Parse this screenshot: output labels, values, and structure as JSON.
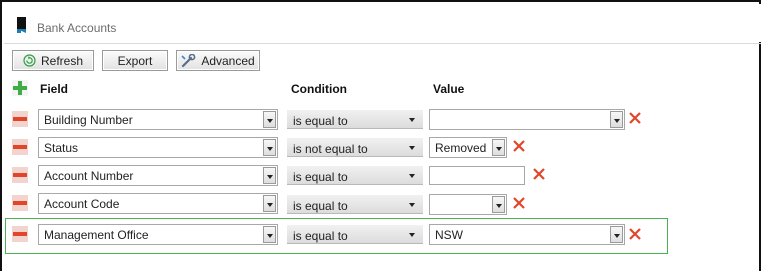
{
  "window": {
    "title": "Bank Accounts"
  },
  "toolbar": {
    "refresh_label": "Refresh",
    "export_label": "Export",
    "advanced_label": "Advanced"
  },
  "headers": {
    "field": "Field",
    "condition": "Condition",
    "value": "Value"
  },
  "filters": [
    {
      "field": "Building Number",
      "condition": "is equal to",
      "value": "",
      "value_type": "dropdown"
    },
    {
      "field": "Status",
      "condition": "is not equal to",
      "value": "Removed",
      "value_type": "dropdown"
    },
    {
      "field": "Account Number",
      "condition": "is equal to",
      "value": "",
      "value_type": "text"
    },
    {
      "field": "Account Code",
      "condition": "is equal to",
      "value": "",
      "value_type": "dropdown"
    },
    {
      "field": "Management Office",
      "condition": "is equal to",
      "value": "NSW",
      "value_type": "dropdown",
      "highlighted": true
    }
  ],
  "icons": {
    "app": "bank-accounts-icon",
    "refresh": "refresh-icon",
    "advanced": "wrench-icon",
    "add": "plus-icon",
    "remove": "minus-icon",
    "delete_value": "close-icon"
  },
  "colors": {
    "add_green": "#3fae49",
    "remove_red": "#e2452a",
    "highlight_border": "#4caf50"
  }
}
